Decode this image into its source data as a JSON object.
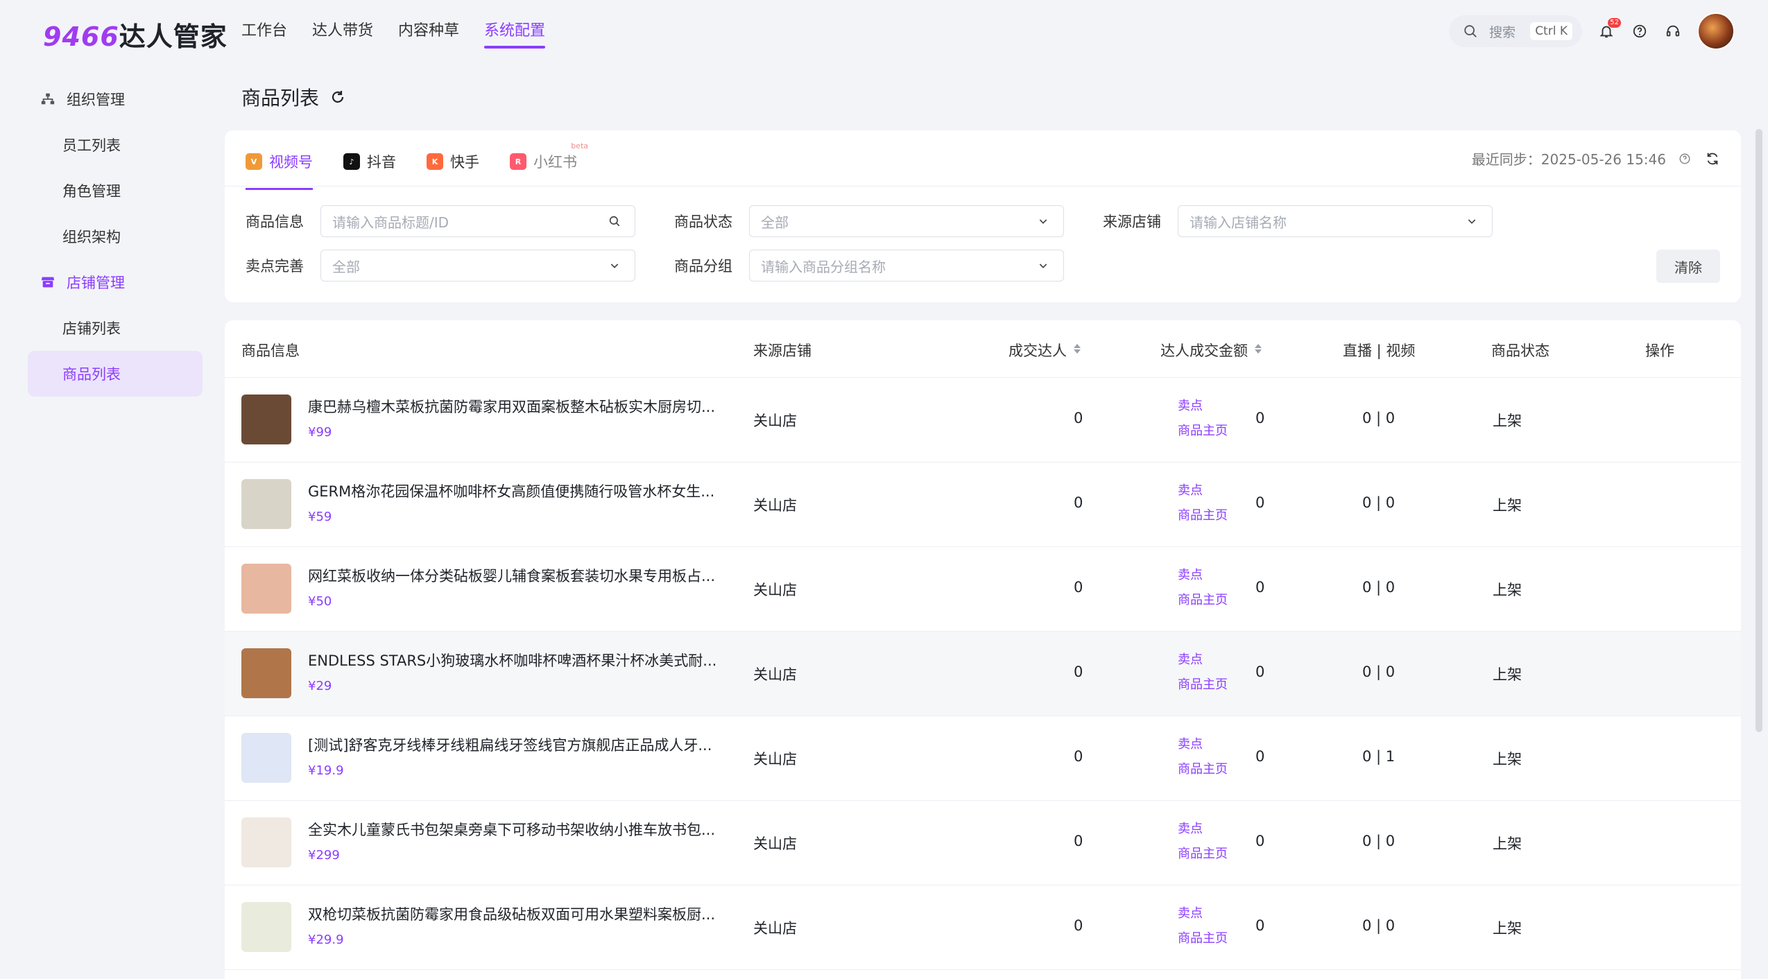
{
  "app": {
    "logo_num": "9466",
    "logo_text": "达人管家"
  },
  "topnav": [
    "工作台",
    "达人带货",
    "内容种草",
    "系统配置"
  ],
  "top_right": {
    "search_placeholder": "搜索",
    "shortcut": "Ctrl K",
    "notice_count": "52"
  },
  "sidebar": {
    "group1": "组织管理",
    "group1_items": [
      "员工列表",
      "角色管理",
      "组织架构"
    ],
    "group2": "店铺管理",
    "group2_items": [
      "店铺列表",
      "商品列表"
    ]
  },
  "page": {
    "title": "商品列表"
  },
  "tabs": [
    {
      "label": "视频号",
      "color": "#f09a37"
    },
    {
      "label": "抖音",
      "color": "#111111"
    },
    {
      "label": "快手",
      "color": "#ff6a3d"
    },
    {
      "label": "小红书",
      "color": "#ff5a6e",
      "tag": "beta"
    }
  ],
  "sync": {
    "text": "最近同步：2025-05-26 15:46"
  },
  "filters": {
    "product_info": {
      "label": "商品信息",
      "placeholder": "请输入商品标题/ID"
    },
    "product_status": {
      "label": "商品状态",
      "value": "全部"
    },
    "source_shop": {
      "label": "来源店铺",
      "placeholder": "请输入店铺名称"
    },
    "selling_point": {
      "label": "卖点完善",
      "value": "全部"
    },
    "product_group": {
      "label": "商品分组",
      "placeholder": "请输入商品分组名称"
    },
    "clear": "清除"
  },
  "table": {
    "headers": [
      "商品信息",
      "来源店铺",
      "成交达人",
      "达人成交金额",
      "直播 | 视频",
      "商品状态",
      "操作"
    ],
    "rows": [
      {
        "title": "康巴赫乌檀木菜板抗菌防霉家用双面案板整木砧板实木厨房切...",
        "price": "¥99",
        "shop": "关山店",
        "creators": "0",
        "amount": "0",
        "live_video": "0 | 0",
        "status": "上架",
        "op1": "卖点",
        "op2": "商品主页",
        "thumb": "#6b4a35"
      },
      {
        "title": "GERM格沵花园保温杯咖啡杯女高颜值便携随行吸管水杯女生...",
        "price": "¥59",
        "shop": "关山店",
        "creators": "0",
        "amount": "0",
        "live_video": "0 | 0",
        "status": "上架",
        "op1": "卖点",
        "op2": "商品主页",
        "thumb": "#d9d4c8"
      },
      {
        "title": "网红菜板收纳一体分类砧板婴儿辅食案板套装切水果专用板占...",
        "price": "¥50",
        "shop": "关山店",
        "creators": "0",
        "amount": "0",
        "live_video": "0 | 0",
        "status": "上架",
        "op1": "卖点",
        "op2": "商品主页",
        "thumb": "#e7b7a0"
      },
      {
        "title": "ENDLESS STARS小狗玻璃水杯咖啡杯啤酒杯果汁杯冰美式耐...",
        "price": "¥29",
        "shop": "关山店",
        "creators": "0",
        "amount": "0",
        "live_video": "0 | 0",
        "status": "上架",
        "op1": "卖点",
        "op2": "商品主页",
        "thumb": "#b0764a"
      },
      {
        "title": "[测试]舒客克牙线棒牙线粗扁线牙签线官方旗舰店正品成人牙...",
        "price": "¥19.9",
        "shop": "关山店",
        "creators": "0",
        "amount": "0",
        "live_video": "0 | 1",
        "status": "上架",
        "op1": "卖点",
        "op2": "商品主页",
        "thumb": "#dfe6f5"
      },
      {
        "title": "全实木儿童蒙氏书包架桌旁桌下可移动书架收纳小推车放书包...",
        "price": "¥299",
        "shop": "关山店",
        "creators": "0",
        "amount": "0",
        "live_video": "0 | 0",
        "status": "上架",
        "op1": "卖点",
        "op2": "商品主页",
        "thumb": "#efe9e2"
      },
      {
        "title": "双枪切菜板抗菌防霉家用食品级砧板双面可用水果塑料案板厨...",
        "price": "¥29.9",
        "shop": "关山店",
        "creators": "0",
        "amount": "0",
        "live_video": "0 | 0",
        "status": "上架",
        "op1": "卖点",
        "op2": "商品主页",
        "thumb": "#e9ecdc"
      }
    ]
  }
}
